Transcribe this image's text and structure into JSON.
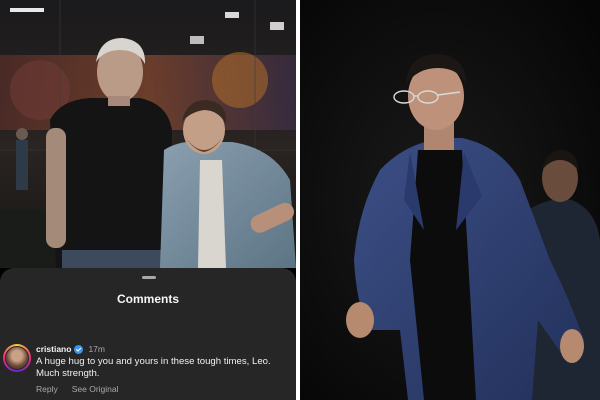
{
  "comments_sheet": {
    "title": "Comments",
    "comment": {
      "username": "cristiano",
      "timestamp": "17m",
      "text": "A huge hug to you and yours in these tough times, Leo. Much strength.",
      "actions": {
        "reply": "Reply",
        "see_original": "See Original"
      }
    }
  },
  "colors": {
    "sheet_background": "#262626",
    "verified_badge": "#3897f0",
    "muted_text": "#a8a8a8"
  },
  "icons": [
    "verified-badge-icon",
    "avatar"
  ]
}
